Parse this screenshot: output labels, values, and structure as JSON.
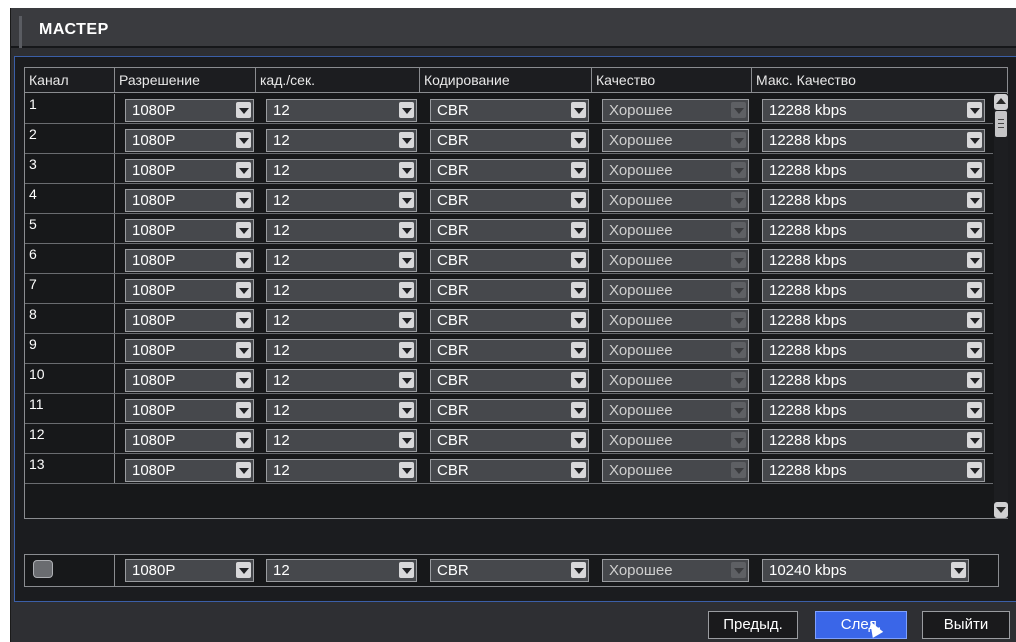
{
  "window": {
    "title": "МАСТЕР"
  },
  "table": {
    "headers": [
      "Канал",
      "Разрешение",
      "кад./сек.",
      "Кодирование",
      "Качество",
      "Макс. Качество"
    ],
    "rows": [
      {
        "channel": "1",
        "resolution": "1080P",
        "fps": "12",
        "encoding": "CBR",
        "quality": "Хорошее",
        "max_quality": "12288 kbps"
      },
      {
        "channel": "2",
        "resolution": "1080P",
        "fps": "12",
        "encoding": "CBR",
        "quality": "Хорошее",
        "max_quality": "12288 kbps"
      },
      {
        "channel": "3",
        "resolution": "1080P",
        "fps": "12",
        "encoding": "CBR",
        "quality": "Хорошее",
        "max_quality": "12288 kbps"
      },
      {
        "channel": "4",
        "resolution": "1080P",
        "fps": "12",
        "encoding": "CBR",
        "quality": "Хорошее",
        "max_quality": "12288 kbps"
      },
      {
        "channel": "5",
        "resolution": "1080P",
        "fps": "12",
        "encoding": "CBR",
        "quality": "Хорошее",
        "max_quality": "12288 kbps"
      },
      {
        "channel": "6",
        "resolution": "1080P",
        "fps": "12",
        "encoding": "CBR",
        "quality": "Хорошее",
        "max_quality": "12288 kbps"
      },
      {
        "channel": "7",
        "resolution": "1080P",
        "fps": "12",
        "encoding": "CBR",
        "quality": "Хорошее",
        "max_quality": "12288 kbps"
      },
      {
        "channel": "8",
        "resolution": "1080P",
        "fps": "12",
        "encoding": "CBR",
        "quality": "Хорошее",
        "max_quality": "12288 kbps"
      },
      {
        "channel": "9",
        "resolution": "1080P",
        "fps": "12",
        "encoding": "CBR",
        "quality": "Хорошее",
        "max_quality": "12288 kbps"
      },
      {
        "channel": "10",
        "resolution": "1080P",
        "fps": "12",
        "encoding": "CBR",
        "quality": "Хорошее",
        "max_quality": "12288 kbps"
      },
      {
        "channel": "11",
        "resolution": "1080P",
        "fps": "12",
        "encoding": "CBR",
        "quality": "Хорошее",
        "max_quality": "12288 kbps"
      },
      {
        "channel": "12",
        "resolution": "1080P",
        "fps": "12",
        "encoding": "CBR",
        "quality": "Хорошее",
        "max_quality": "12288 kbps"
      },
      {
        "channel": "13",
        "resolution": "1080P",
        "fps": "12",
        "encoding": "CBR",
        "quality": "Хорошее",
        "max_quality": "12288 kbps"
      }
    ]
  },
  "all_row": {
    "checked": false,
    "resolution": "1080P",
    "fps": "12",
    "encoding": "CBR",
    "quality": "Хорошее",
    "max_quality": "10240 kbps"
  },
  "buttons": {
    "prev": "Предыд.",
    "next": "След.",
    "exit": "Выйти"
  },
  "colors": {
    "accent": "#3a66e8",
    "panel_border": "#3b5fa8",
    "background": "#2e2f33"
  }
}
